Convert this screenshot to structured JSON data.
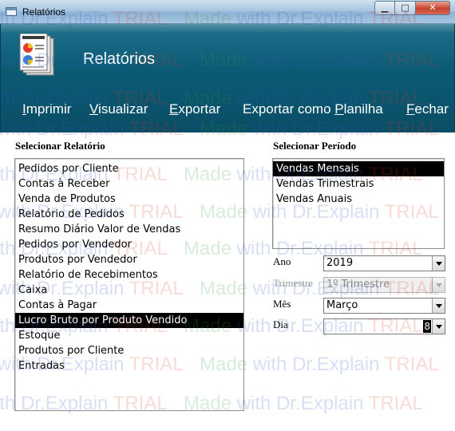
{
  "window": {
    "title": "Relatórios",
    "buttons": {
      "minimize": "▁",
      "maximize": "□",
      "close": "✕"
    }
  },
  "header": {
    "title": "Relatórios",
    "icon": "reports-document-icon"
  },
  "menu": {
    "items": [
      {
        "pre": "",
        "acc": "I",
        "post": "mprimir"
      },
      {
        "pre": "",
        "acc": "V",
        "post": "isualizar"
      },
      {
        "pre": "",
        "acc": "E",
        "post": "xportar"
      },
      {
        "pre": "Exportar como ",
        "acc": "P",
        "post": "lanilha"
      },
      {
        "pre": "",
        "acc": "F",
        "post": "echar"
      }
    ]
  },
  "reports": {
    "label": "Selecionar Relatório",
    "selected_index": 10,
    "items": [
      "Pedidos por Cliente",
      "Contas à Receber",
      "Venda de Produtos",
      "Relatório de Pedidos",
      "Resumo Diário Valor de Vendas",
      "Pedidos por Vendedor",
      "Produtos por Vendedor",
      "Relatório de Recebimentos",
      "Caixa",
      "Contas à Pagar",
      "Lucro Bruto por Produto Vendido",
      "Estoque",
      "Produtos por Cliente",
      "Entradas"
    ]
  },
  "period": {
    "label": "Selecionar Período",
    "selected_index": 0,
    "items": [
      "Vendas Mensais",
      "Vendas Trimestrais",
      "Vendas Anuais"
    ]
  },
  "fields": {
    "ano": {
      "label": "Ano",
      "value": "2019"
    },
    "trimestre": {
      "label": "Trimestre",
      "value": "1º Trimestre"
    },
    "mes": {
      "label": "Mês",
      "value": "Março"
    },
    "dia": {
      "label": "Dia",
      "value": "8"
    }
  },
  "watermark": {
    "text_parts": [
      "Made",
      " with ",
      "Dr.Explain",
      " TRIAL"
    ]
  },
  "colors": {
    "header_bg": "#0b5a74",
    "selection_bg": "#000000",
    "selection_fg": "#ffffff"
  }
}
